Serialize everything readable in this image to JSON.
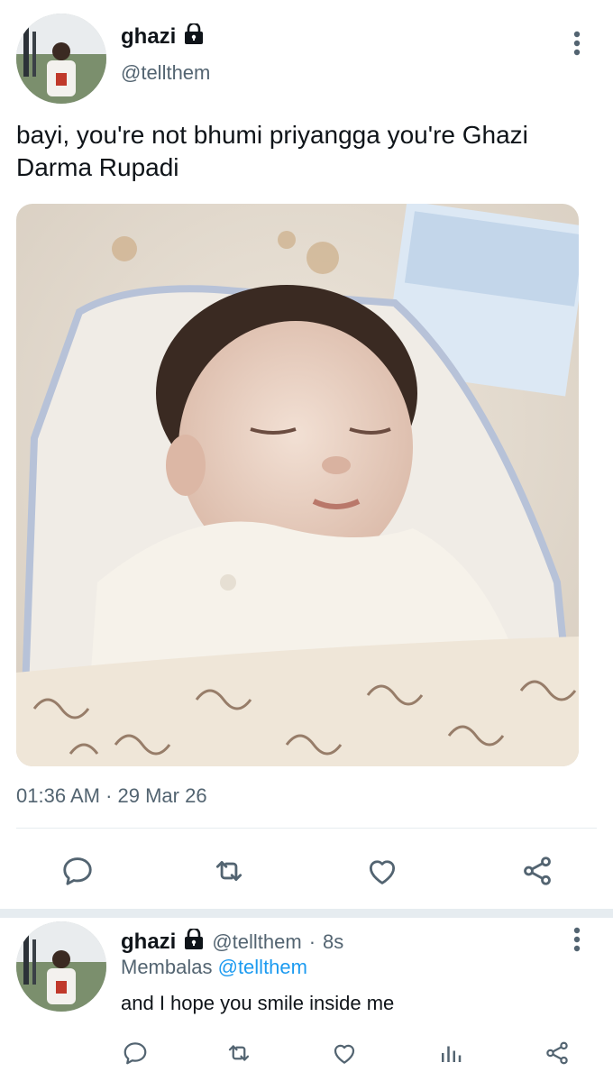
{
  "tweet": {
    "display_name": "ghazi",
    "handle": "@tellthem",
    "text": "bayi, you're not bhumi priyangga you're Ghazi Darma Rupadi",
    "timestamp": "01:36 AM · 29 Mar 26",
    "locked": true
  },
  "actions": {
    "reply_icon": "reply-icon",
    "retweet_icon": "retweet-icon",
    "like_icon": "heart-icon",
    "share_icon": "share-icon"
  },
  "reply": {
    "display_name": "ghazi",
    "handle": "@tellthem",
    "time_sep": "·",
    "time": "8s",
    "replying_prefix": "Membalas",
    "replying_to": "@tellthem",
    "text": "and I hope you smile inside me"
  },
  "colors": {
    "text_primary": "#0f1419",
    "text_secondary": "#536471",
    "link": "#1d9bf0",
    "divider": "#e6ecf0"
  }
}
